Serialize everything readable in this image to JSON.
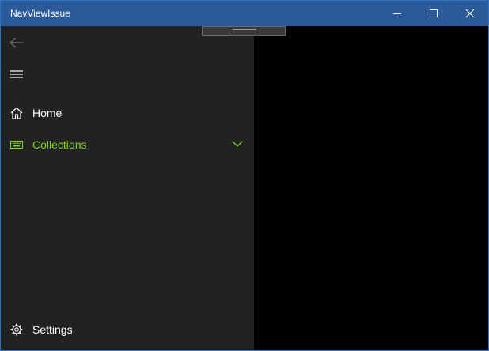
{
  "window": {
    "title": "NavViewIssue",
    "colors": {
      "titlebar": "#2b5a9a",
      "border": "#3173c2",
      "pane": "#222222",
      "content": "#000000",
      "accent": "#7fd41f"
    }
  },
  "titlebar_buttons": [
    {
      "name": "minimize",
      "icon": "minimize-icon"
    },
    {
      "name": "maximize",
      "icon": "maximize-icon"
    },
    {
      "name": "close",
      "icon": "close-icon"
    }
  ],
  "nav": {
    "back": {
      "icon": "back-arrow-icon",
      "enabled": false
    },
    "menu": {
      "icon": "hamburger-icon"
    },
    "items": [
      {
        "label": "Home",
        "icon": "home-icon",
        "selected": false
      },
      {
        "label": "Collections",
        "icon": "keyboard-icon",
        "selected": true,
        "expandable": true,
        "chevron": "chevron-down-icon"
      }
    ],
    "footer": {
      "label": "Settings",
      "icon": "gear-icon"
    }
  }
}
